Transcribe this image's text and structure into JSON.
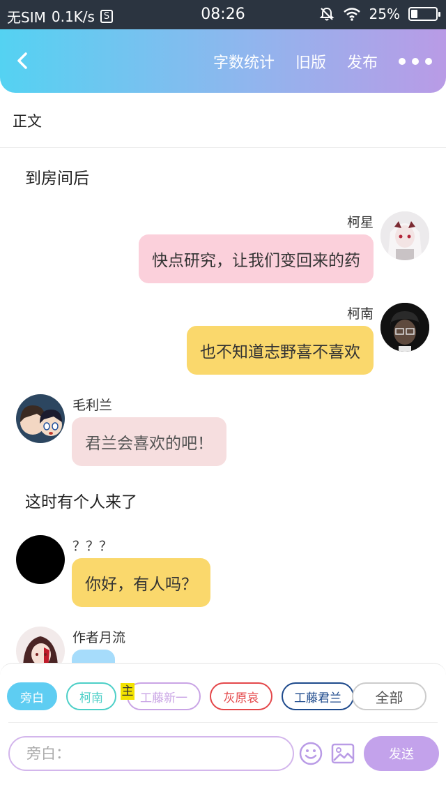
{
  "status_bar": {
    "carrier": "无SIM",
    "speed": "0.1K/s",
    "sim_icon_letter": "S",
    "time": "08:26",
    "battery": "25%",
    "battery_level": 0.25
  },
  "header": {
    "back_icon": "chevron-left-icon",
    "actions": [
      "字数统计",
      "旧版",
      "发布"
    ],
    "more_icon": "more-dots-icon"
  },
  "section_label": "正文",
  "narrations": [
    "到房间后",
    "这时有个人来了"
  ],
  "messages": [
    {
      "speaker": "柯星",
      "text": "快点研究，让我们变回来的药",
      "bubble_color": "#fbd0db"
    },
    {
      "speaker": "柯南",
      "text": "也不知道志野喜不喜欢",
      "bubble_color": "#fad86c"
    },
    {
      "speaker": "毛利兰",
      "text": "君兰会喜欢的吧！",
      "bubble_color": "#f6dedf"
    },
    {
      "speaker": "？？？",
      "text": "你好，有人吗？",
      "bubble_color": "#fad86c"
    },
    {
      "speaker": "作者月流",
      "text": "",
      "bubble_color": "#a6dcfb"
    }
  ],
  "characters": [
    {
      "label": "旁白",
      "color": "#5ecdf2",
      "selected": true
    },
    {
      "label": "柯南",
      "color": "#4ccfc7"
    },
    {
      "label": "工藤新一",
      "color": "#c9a4e5"
    },
    {
      "label": "灰原哀",
      "color": "#e4474a"
    },
    {
      "label": "工藤君兰",
      "color": "#1e4a8c"
    },
    {
      "label": "全部",
      "color": "#cccccc"
    }
  ],
  "main_tag": "主",
  "input": {
    "placeholder": "旁白："
  },
  "emoji_icon": "smile-icon",
  "image_icon": "image-icon",
  "send_label": "发送"
}
